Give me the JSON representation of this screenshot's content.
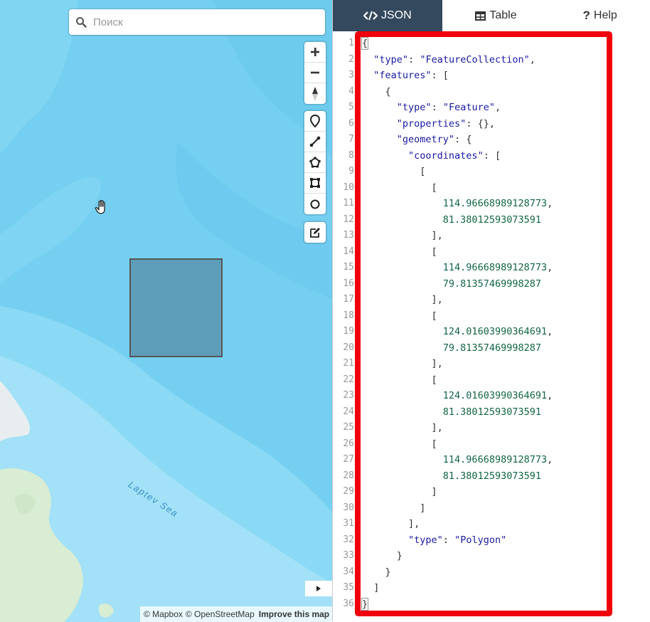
{
  "search": {
    "placeholder": "Поиск"
  },
  "map": {
    "zoom_in_label": "+",
    "zoom_out_label": "−",
    "sea_label": "Laptev Sea",
    "attribution": {
      "mapbox": "© Mapbox",
      "osm": "© OpenStreetMap",
      "improve": "Improve this map"
    },
    "colors": {
      "water": "#75cff0",
      "land": "#d9ecd4",
      "polygon_fill": "#558ca8"
    }
  },
  "tabs": [
    {
      "label": "JSON",
      "icon": "code-icon",
      "active": true
    },
    {
      "label": "Table",
      "icon": "table-icon",
      "active": false
    },
    {
      "label": "Help",
      "icon": "question-icon",
      "active": false
    }
  ],
  "editor": {
    "line_numbers": [
      "1",
      "2",
      "3",
      "4",
      "5",
      "6",
      "7",
      "8",
      "9",
      "10",
      "11",
      "12",
      "13",
      "14",
      "15",
      "16",
      "17",
      "18",
      "19",
      "20",
      "21",
      "22",
      "23",
      "24",
      "25",
      "26",
      "27",
      "28",
      "29",
      "30",
      "31",
      "32",
      "33",
      "34",
      "35",
      "36"
    ],
    "lines": [
      "{",
      "  \"type\": \"FeatureCollection\",",
      "  \"features\": [",
      "    {",
      "      \"type\": \"Feature\",",
      "      \"properties\": {},",
      "      \"geometry\": {",
      "        \"coordinates\": [",
      "          [",
      "            [",
      "              114.96668989128773,",
      "              81.38012593073591",
      "            ],",
      "            [",
      "              114.96668989128773,",
      "              79.81357469998287",
      "            ],",
      "            [",
      "              124.01603990364691,",
      "              79.81357469998287",
      "            ],",
      "            [",
      "              124.01603990364691,",
      "              81.38012593073591",
      "            ],",
      "            [",
      "              114.96668989128773,",
      "              81.38012593073591",
      "            ]",
      "          ]",
      "        ],",
      "        \"type\": \"Polygon\"",
      "      }",
      "    }",
      "  ]",
      "}"
    ],
    "highlight_color": "#f0000a"
  }
}
